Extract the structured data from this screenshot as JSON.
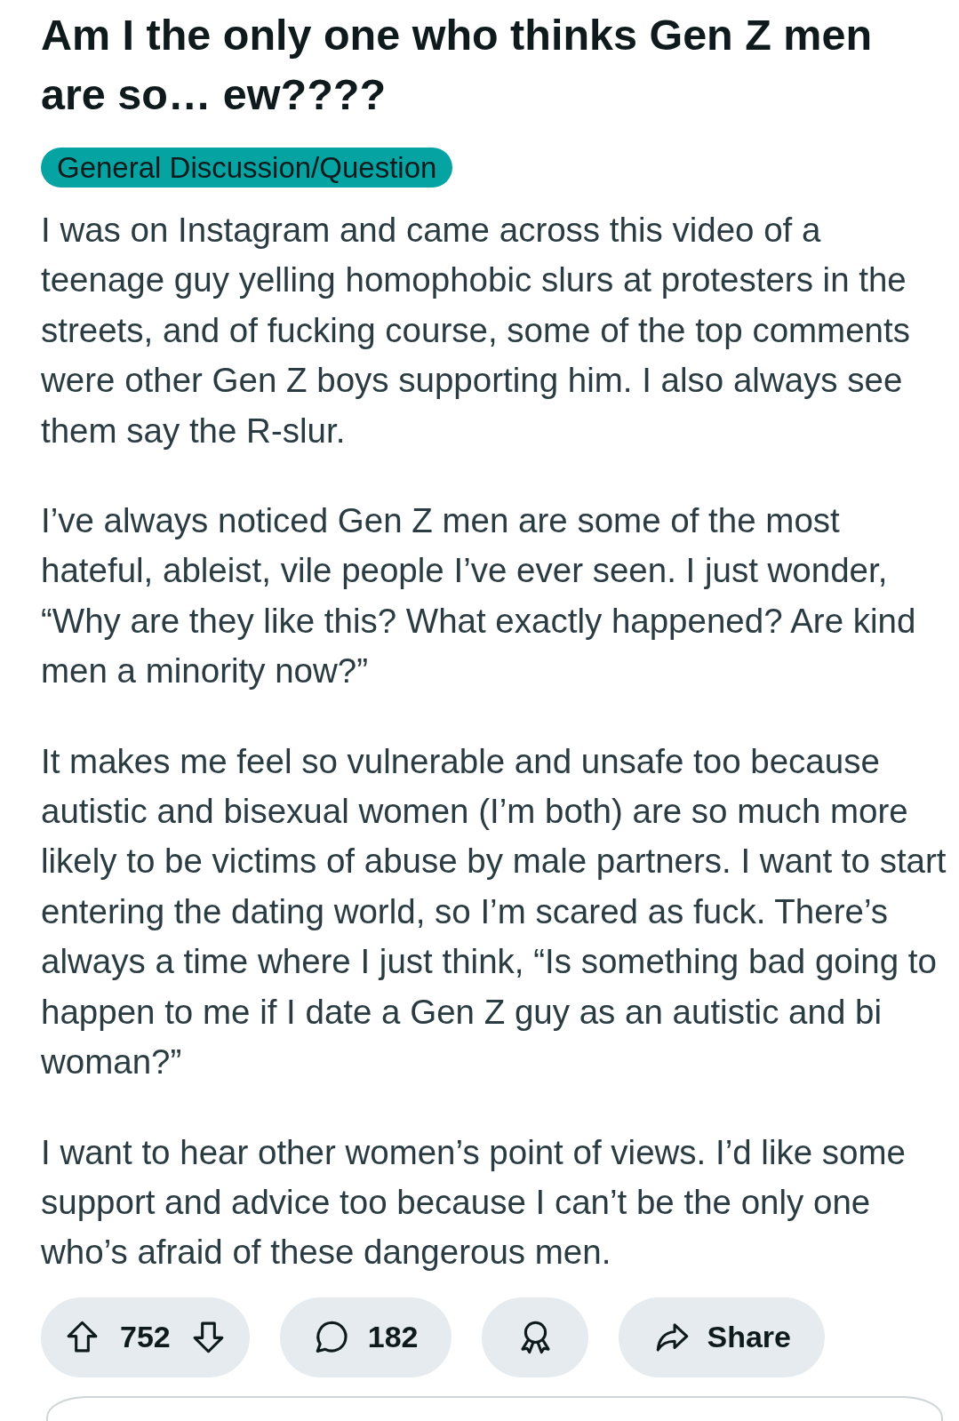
{
  "post": {
    "title": "Am I the only one who thinks Gen Z men are so… ew????",
    "flair": "General Discussion/Question",
    "body": [
      "I was on Instagram and came across this video of a teenage guy yelling homophobic slurs at protesters in the streets, and of fucking course, some of the top comments were other Gen Z boys supporting him. I also always see them say the R-slur.",
      "I’ve always noticed Gen Z men are some of the most hateful, ableist, vile people I’ve ever seen. I just wonder, “Why are they like this? What exactly happened? Are kind men a minority now?”",
      "It makes me feel so vulnerable and unsafe too because autistic and bisexual women (I’m both) are so much more likely to be victims of abuse by male partners. I want to start entering the dating world, so I’m scared as fuck. There’s always a time where I just think, “Is something bad going to happen to me if I date a Gen Z guy as an autistic and bi woman?”",
      "I want to hear other women’s point of views. I’d like some support and advice too because I can’t be the only one who’s afraid of these dangerous men."
    ]
  },
  "actions": [
    {
      "kind": "vote",
      "count": "752"
    },
    {
      "kind": "comments",
      "count": "182"
    },
    {
      "kind": "award"
    },
    {
      "kind": "share",
      "label": "Share"
    }
  ]
}
